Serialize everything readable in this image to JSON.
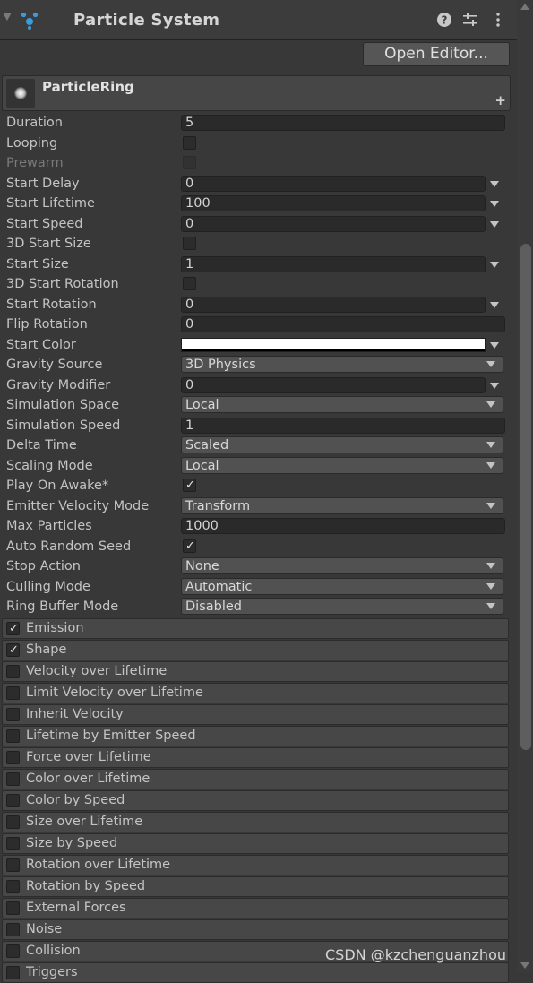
{
  "header": {
    "title": "Particle System"
  },
  "toolbar": {
    "open_editor": "Open Editor..."
  },
  "sub": {
    "name": "ParticleRing"
  },
  "props": [
    {
      "label": "Duration",
      "kind": "text",
      "value": "5",
      "wide": true
    },
    {
      "label": "Looping",
      "kind": "check",
      "checked": false
    },
    {
      "label": "Prewarm",
      "kind": "check",
      "checked": false,
      "disabled": true
    },
    {
      "label": "Start Delay",
      "kind": "text",
      "value": "0",
      "wide": false
    },
    {
      "label": "Start Lifetime",
      "kind": "text",
      "value": "100",
      "wide": false
    },
    {
      "label": "Start Speed",
      "kind": "text",
      "value": "0",
      "wide": false
    },
    {
      "label": "3D Start Size",
      "kind": "check",
      "checked": false
    },
    {
      "label": "Start Size",
      "kind": "text",
      "value": "1",
      "wide": false
    },
    {
      "label": "3D Start Rotation",
      "kind": "check",
      "checked": false
    },
    {
      "label": "Start Rotation",
      "kind": "text",
      "value": "0",
      "wide": false
    },
    {
      "label": "Flip Rotation",
      "kind": "text",
      "value": "0",
      "wide": true
    },
    {
      "label": "Start Color",
      "kind": "color",
      "value": "#ffffff"
    },
    {
      "label": "Gravity Source",
      "kind": "select",
      "value": "3D Physics"
    },
    {
      "label": "Gravity Modifier",
      "kind": "text",
      "value": "0",
      "wide": false
    },
    {
      "label": "Simulation Space",
      "kind": "select",
      "value": "Local"
    },
    {
      "label": "Simulation Speed",
      "kind": "text",
      "value": "1",
      "wide": true
    },
    {
      "label": "Delta Time",
      "kind": "select",
      "value": "Scaled"
    },
    {
      "label": "Scaling Mode",
      "kind": "select",
      "value": "Local"
    },
    {
      "label": "Play On Awake*",
      "kind": "check",
      "checked": true
    },
    {
      "label": "Emitter Velocity Mode",
      "kind": "select",
      "value": "Transform"
    },
    {
      "label": "Max Particles",
      "kind": "text",
      "value": "1000",
      "wide": true
    },
    {
      "label": "Auto Random Seed",
      "kind": "check",
      "checked": true
    },
    {
      "label": "Stop Action",
      "kind": "select",
      "value": "None"
    },
    {
      "label": "Culling Mode",
      "kind": "select",
      "value": "Automatic"
    },
    {
      "label": "Ring Buffer Mode",
      "kind": "select",
      "value": "Disabled"
    }
  ],
  "modules": [
    {
      "label": "Emission",
      "checked": true
    },
    {
      "label": "Shape",
      "checked": true
    },
    {
      "label": "Velocity over Lifetime",
      "checked": false
    },
    {
      "label": "Limit Velocity over Lifetime",
      "checked": false
    },
    {
      "label": "Inherit Velocity",
      "checked": false
    },
    {
      "label": "Lifetime by Emitter Speed",
      "checked": false
    },
    {
      "label": "Force over Lifetime",
      "checked": false
    },
    {
      "label": "Color over Lifetime",
      "checked": false
    },
    {
      "label": "Color by Speed",
      "checked": false
    },
    {
      "label": "Size over Lifetime",
      "checked": false
    },
    {
      "label": "Size by Speed",
      "checked": false
    },
    {
      "label": "Rotation over Lifetime",
      "checked": false
    },
    {
      "label": "Rotation by Speed",
      "checked": false
    },
    {
      "label": "External Forces",
      "checked": false
    },
    {
      "label": "Noise",
      "checked": false
    },
    {
      "label": "Collision",
      "checked": false
    },
    {
      "label": "Triggers",
      "checked": false
    }
  ],
  "watermark": "CSDN @kzchenguanzhou",
  "icons": {
    "component": "particle-system-icon",
    "help": "help-icon",
    "presets": "presets-icon",
    "menu": "kebab-menu-icon",
    "add": "plus-icon",
    "check": "checkmark-icon"
  },
  "colors": {
    "accent": "#3d9bd8",
    "background": "#383838"
  }
}
